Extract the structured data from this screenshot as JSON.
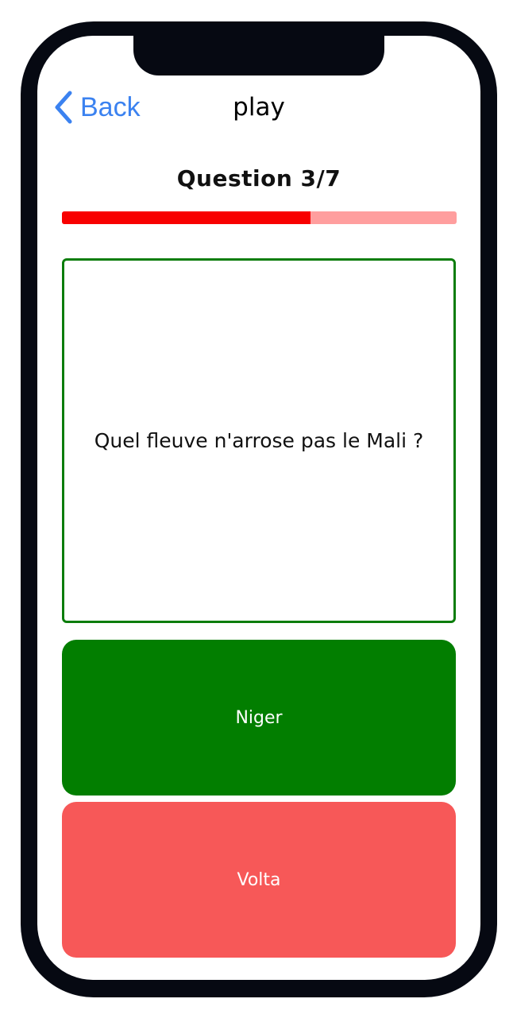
{
  "nav": {
    "back_label": "Back",
    "title": "play"
  },
  "quiz": {
    "counter": "Question 3/7",
    "progress_fraction": 0.63,
    "question": "Quel fleuve n'arrose pas le Mali ?",
    "answers": [
      {
        "label": "Niger",
        "color": "#027e00"
      },
      {
        "label": "Volta",
        "color": "#f75858"
      }
    ]
  },
  "colors": {
    "accent_blue": "#3b82f0",
    "progress_fill": "#f80000",
    "progress_track": "#ff9e9e",
    "card_border": "#0b7d0b"
  },
  "icons": {
    "back": "chevron-left-icon"
  }
}
